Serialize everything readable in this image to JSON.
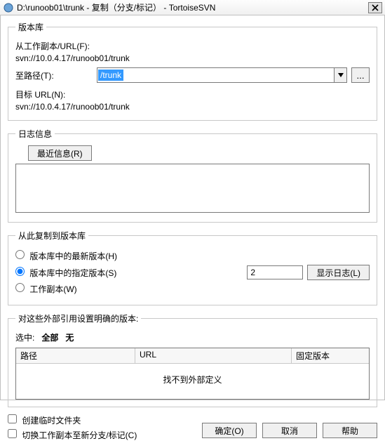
{
  "window": {
    "title": "D:\\runoob01\\trunk - 复制（分支/标记） - TortoiseSVN",
    "close": "✕"
  },
  "repo": {
    "legend": "版本库",
    "from_label": "从工作副本/URL(F):",
    "from_value": "svn://10.0.4.17/runoob01/trunk",
    "to_label": "至路径(T):",
    "to_selected": "/trunk",
    "browse": "...",
    "target_label": "目标 URL(N):",
    "target_value": "svn://10.0.4.17/runoob01/trunk"
  },
  "log": {
    "legend": "日志信息",
    "recent_btn": "最近信息(R)",
    "text": ""
  },
  "copy": {
    "legend": "从此复制到版本库",
    "radio_head": "版本库中的最新版本(H)",
    "radio_spec": "版本库中的指定版本(S)",
    "radio_wc": "工作副本(W)",
    "rev_value": "2",
    "show_log_btn": "显示日志(L)"
  },
  "externals": {
    "legend": "对这些外部引用设置明确的版本:",
    "select_prefix": "选中:",
    "select_all": "全部",
    "select_none": "无",
    "col_path": "路径",
    "col_url": "URL",
    "col_rev": "固定版本",
    "empty_text": "找不到外部定义"
  },
  "checks": {
    "create_temp": "创建临时文件夹",
    "switch_wc": "切换工作副本至新分支/标记(C)"
  },
  "buttons": {
    "ok": "确定(O)",
    "cancel": "取消",
    "help": "帮助"
  }
}
